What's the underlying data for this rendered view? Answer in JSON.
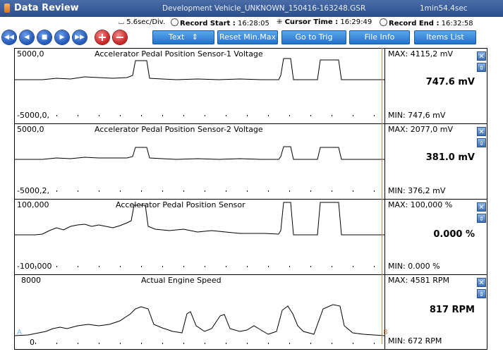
{
  "window": {
    "title": "Data Review",
    "filename": "Development Vehicle_UNKNOWN_150416-163248.GSR",
    "duration": "1min54.4sec"
  },
  "info": {
    "scale": "5.6sec/Div.",
    "record_start_label": "Record Start :",
    "record_start": "16:28:05",
    "cursor_time_label": "Cursor Time :",
    "cursor_time": "16:29:49",
    "record_end_label": "Record End :",
    "record_end": "16:32:58"
  },
  "toolbar": {
    "text_label": "Text",
    "text_arrow": "⇕",
    "reset_label": "Reset Min.Max",
    "trig_label": "Go to Trig",
    "fileinfo_label": "File Info",
    "items_label": "Items List",
    "plus_glyph": "+",
    "minus_glyph": "−"
  },
  "markers": {
    "a": "A",
    "b": "B"
  },
  "graphs": [
    {
      "title": "Accelerator Pedal Position Sensor-1 Voltage",
      "ymax": "5000,0",
      "ymin": "-5000,0,",
      "max_text": "MAX: 4115,2 mV",
      "min_text": "MIN: 747,6 mV",
      "current": "747.6 mV"
    },
    {
      "title": "Accelerator Pedal Position Sensor-2 Voltage",
      "ymax": "5000,0",
      "ymin": "-5000,2,",
      "max_text": "MAX: 2077,0 mV",
      "min_text": "MIN: 376,2 mV",
      "current": "381.0 mV"
    },
    {
      "title": "Accelerator Pedal Position Sensor",
      "ymax": "100,000",
      "ymin": "-100,000",
      "max_text": "MAX: 100,000 %",
      "min_text": "MIN: 0.000 %",
      "current": "0.000 %"
    },
    {
      "title": "Actual Engine Speed",
      "ymax": "8000",
      "ymin": "0",
      "max_text": "MAX:  4581 RPM",
      "min_text": "MIN:  672 RPM",
      "current": "817 RPM"
    }
  ],
  "colors": {
    "titlebar": "#2c4f8c",
    "button": "#1d6fc9",
    "cursor": "#c58a5a"
  },
  "icons": {
    "close": "close-icon",
    "scale": "scale-updown-icon",
    "rewind": "rewind-icon",
    "prev": "step-back-icon",
    "stop": "stop-icon",
    "next": "step-forward-icon",
    "forward": "fast-forward-icon"
  }
}
